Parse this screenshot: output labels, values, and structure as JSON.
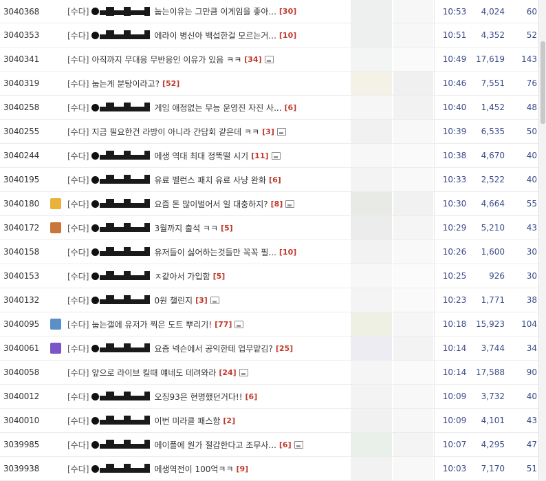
{
  "board": {
    "rows": [
      {
        "num": "3040368",
        "icon": "",
        "cat": "[수다]",
        "nick": true,
        "title": "눕는이유는 그만큼 이게임을 좋아...",
        "comments": "[30]",
        "img": false,
        "time": "10:53",
        "views": "4,024",
        "likes": "60",
        "thumb1": "#eef0f0",
        "thumb2": "#f7f7f7"
      },
      {
        "num": "3040353",
        "icon": "",
        "cat": "[수다]",
        "nick": true,
        "title": "에라이 병신아 백섭한걸 모르는거...",
        "comments": "[10]",
        "img": false,
        "time": "10:51",
        "views": "4,352",
        "likes": "52",
        "thumb1": "#eef0f0",
        "thumb2": "#f7f7f7"
      },
      {
        "num": "3040341",
        "icon": "",
        "cat": "[수다]",
        "nick": false,
        "title": "아직까지 무대응 무반응인 이유가 있음 ㅋㅋ",
        "comments": "[34]",
        "img": true,
        "time": "10:49",
        "views": "17,619",
        "likes": "143",
        "thumb1": "#f3f4f4",
        "thumb2": "#fafafa"
      },
      {
        "num": "3040319",
        "icon": "",
        "cat": "[수다]",
        "nick": false,
        "title": "눕는게 분탕이라고?",
        "comments": "[52]",
        "img": false,
        "time": "10:46",
        "views": "7,551",
        "likes": "76",
        "thumb1": "#f4f1e6",
        "thumb2": "#f0f0f0"
      },
      {
        "num": "3040258",
        "icon": "",
        "cat": "[수다]",
        "nick": true,
        "title": "게임 애정없는 무능 운영진 자진 사...",
        "comments": "[6]",
        "img": false,
        "time": "10:40",
        "views": "1,452",
        "likes": "48",
        "thumb1": "#f6f6f6",
        "thumb2": "#f2f2f2"
      },
      {
        "num": "3040255",
        "icon": "",
        "cat": "[수다]",
        "nick": false,
        "title": "지금 필요한건 라방이 아니라 간담회 같은데 ㅋㅋ",
        "comments": "[3]",
        "img": true,
        "time": "10:39",
        "views": "6,535",
        "likes": "50",
        "thumb1": "#f1f1f1",
        "thumb2": "#f8f8f8"
      },
      {
        "num": "3040244",
        "icon": "",
        "cat": "[수다]",
        "nick": true,
        "title": "메생 역대 최대 정뚝떨 시기",
        "comments": "[11]",
        "img": true,
        "time": "10:38",
        "views": "4,670",
        "likes": "40",
        "thumb1": "#f7f7f7",
        "thumb2": "#fafafa"
      },
      {
        "num": "3040195",
        "icon": "",
        "cat": "[수다]",
        "nick": true,
        "title": "유료 벨런스 패치 유료 사냥 완화",
        "comments": "[6]",
        "img": false,
        "time": "10:33",
        "views": "2,522",
        "likes": "40",
        "thumb1": "#f3f3f3",
        "thumb2": "#f9f9f9"
      },
      {
        "num": "3040180",
        "icon": "#e9b23b",
        "cat": "[수다]",
        "nick": true,
        "title": "요즘 돈 많이벌어서 일 대충하지?",
        "comments": "[8]",
        "img": true,
        "time": "10:30",
        "views": "4,664",
        "likes": "55",
        "thumb1": "#e8eae6",
        "thumb2": "#f1f1f1"
      },
      {
        "num": "3040172",
        "icon": "#c8763a",
        "cat": "[수다]",
        "nick": true,
        "title": "3월까지 출석 ㅋㅋ",
        "comments": "[5]",
        "img": false,
        "time": "10:29",
        "views": "5,210",
        "likes": "43",
        "thumb1": "#ececec",
        "thumb2": "#f5f5f5"
      },
      {
        "num": "3040158",
        "icon": "",
        "cat": "[수다]",
        "nick": true,
        "title": "유저들이 싫어하는것들만 꼭꼭 필...",
        "comments": "[10]",
        "img": false,
        "time": "10:26",
        "views": "1,600",
        "likes": "30",
        "thumb1": "#f2f2f2",
        "thumb2": "#f9f9f9"
      },
      {
        "num": "3040153",
        "icon": "",
        "cat": "[수다]",
        "nick": true,
        "title": "ㅈ같아서 가입함",
        "comments": "[5]",
        "img": false,
        "time": "10:25",
        "views": "926",
        "likes": "30",
        "thumb1": "#f7f7f7",
        "thumb2": "#fbfbfb"
      },
      {
        "num": "3040132",
        "icon": "",
        "cat": "[수다]",
        "nick": true,
        "title": "0원 챌린지",
        "comments": "[3]",
        "img": true,
        "time": "10:23",
        "views": "1,771",
        "likes": "38",
        "thumb1": "#f4f4f4",
        "thumb2": "#fafafa"
      },
      {
        "num": "3040095",
        "icon": "#5b8fc7",
        "cat": "[수다]",
        "nick": false,
        "title": "눕는갤에 유저가 찍은 도트 뿌리기!",
        "comments": "[77]",
        "img": true,
        "time": "10:18",
        "views": "15,923",
        "likes": "104",
        "thumb1": "#eef0e4",
        "thumb2": "#f6f6f6"
      },
      {
        "num": "3040061",
        "icon": "#7a56c9",
        "cat": "[수다]",
        "nick": true,
        "title": "요즘 넥슨에서 공익한테 업무맡김?",
        "comments": "[25]",
        "img": false,
        "time": "10:14",
        "views": "3,744",
        "likes": "34",
        "thumb1": "#ececf2",
        "thumb2": "#f3f3f3"
      },
      {
        "num": "3040058",
        "icon": "",
        "cat": "[수다]",
        "nick": false,
        "title": "앞으로 라이브 킬때 얘네도 데려와라",
        "comments": "[24]",
        "img": true,
        "time": "10:14",
        "views": "17,588",
        "likes": "90",
        "thumb1": "#f5f5f5",
        "thumb2": "#fafafa"
      },
      {
        "num": "3040012",
        "icon": "",
        "cat": "[수다]",
        "nick": true,
        "title": "오징93은 현명했던거다!!",
        "comments": "[6]",
        "img": false,
        "time": "10:09",
        "views": "3,732",
        "likes": "40",
        "thumb1": "#f3f3f3",
        "thumb2": "#f8f8f8"
      },
      {
        "num": "3040010",
        "icon": "",
        "cat": "[수다]",
        "nick": true,
        "title": "이번 미라클 패스함",
        "comments": "[2]",
        "img": false,
        "time": "10:09",
        "views": "4,101",
        "likes": "43",
        "thumb1": "#f1f1f1",
        "thumb2": "#f7f7f7"
      },
      {
        "num": "3039985",
        "icon": "",
        "cat": "[수다]",
        "nick": true,
        "title": "메이플에 원가 절감한다고 조무사...",
        "comments": "[6]",
        "img": true,
        "time": "10:07",
        "views": "4,295",
        "likes": "47",
        "thumb1": "#e9efe9",
        "thumb2": "#f4f4f4"
      },
      {
        "num": "3039938",
        "icon": "",
        "cat": "[수다]",
        "nick": true,
        "title": "메생역전이 100억ㅋㅋ",
        "comments": "[9]",
        "img": false,
        "time": "10:03",
        "views": "7,170",
        "likes": "51",
        "thumb1": "#f2f2f2",
        "thumb2": "#f8f8f8"
      }
    ]
  }
}
